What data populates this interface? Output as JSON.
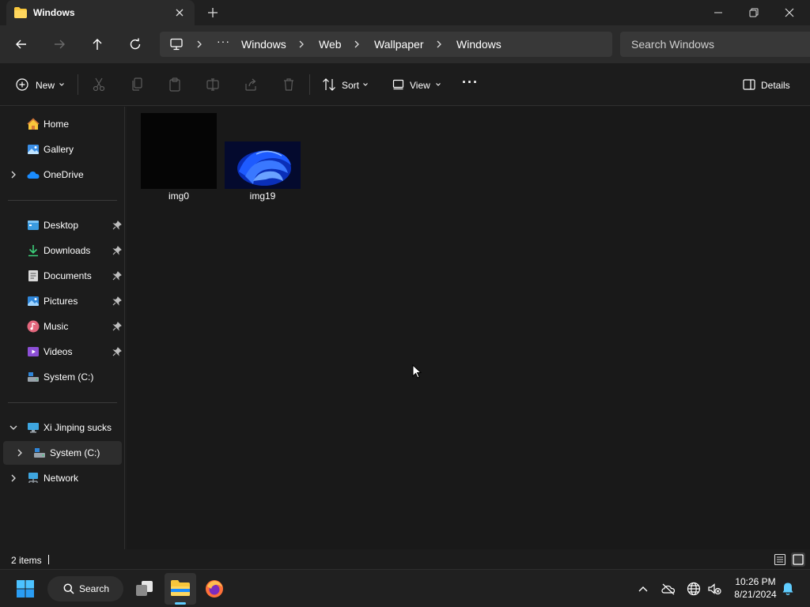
{
  "window": {
    "tab_title": "Windows",
    "new_tab_icon": "plus-icon"
  },
  "address": {
    "breadcrumbs": [
      "Windows",
      "Web",
      "Wallpaper",
      "Windows"
    ],
    "more": "···",
    "search_placeholder": "Search Windows"
  },
  "toolbar": {
    "new_label": "New",
    "sort_label": "Sort",
    "view_label": "View",
    "more": "···",
    "details_label": "Details"
  },
  "sidebar": {
    "quick": [
      {
        "label": "Home",
        "icon": "home-icon"
      },
      {
        "label": "Gallery",
        "icon": "gallery-icon"
      },
      {
        "label": "OneDrive",
        "icon": "onedrive-icon"
      }
    ],
    "pinned": [
      {
        "label": "Desktop",
        "icon": "desktop-icon"
      },
      {
        "label": "Downloads",
        "icon": "downloads-icon"
      },
      {
        "label": "Documents",
        "icon": "documents-icon"
      },
      {
        "label": "Pictures",
        "icon": "pictures-icon"
      },
      {
        "label": "Music",
        "icon": "music-icon"
      },
      {
        "label": "Videos",
        "icon": "videos-icon"
      },
      {
        "label": "System (C:)",
        "icon": "drive-icon"
      }
    ],
    "tree": [
      {
        "label": "Xi Jinping sucks",
        "icon": "this-pc-icon"
      },
      {
        "label": "System (C:)",
        "icon": "drive-icon"
      },
      {
        "label": "Network",
        "icon": "network-icon"
      }
    ]
  },
  "files": [
    {
      "name": "img0"
    },
    {
      "name": "img19"
    }
  ],
  "status": {
    "item_count": "2 items"
  },
  "taskbar": {
    "search_label": "Search",
    "time": "10:26 PM",
    "date": "8/21/2024"
  },
  "colors": {
    "accent": "#60cdff",
    "folder": "#f8c63b",
    "background": "#191919"
  }
}
